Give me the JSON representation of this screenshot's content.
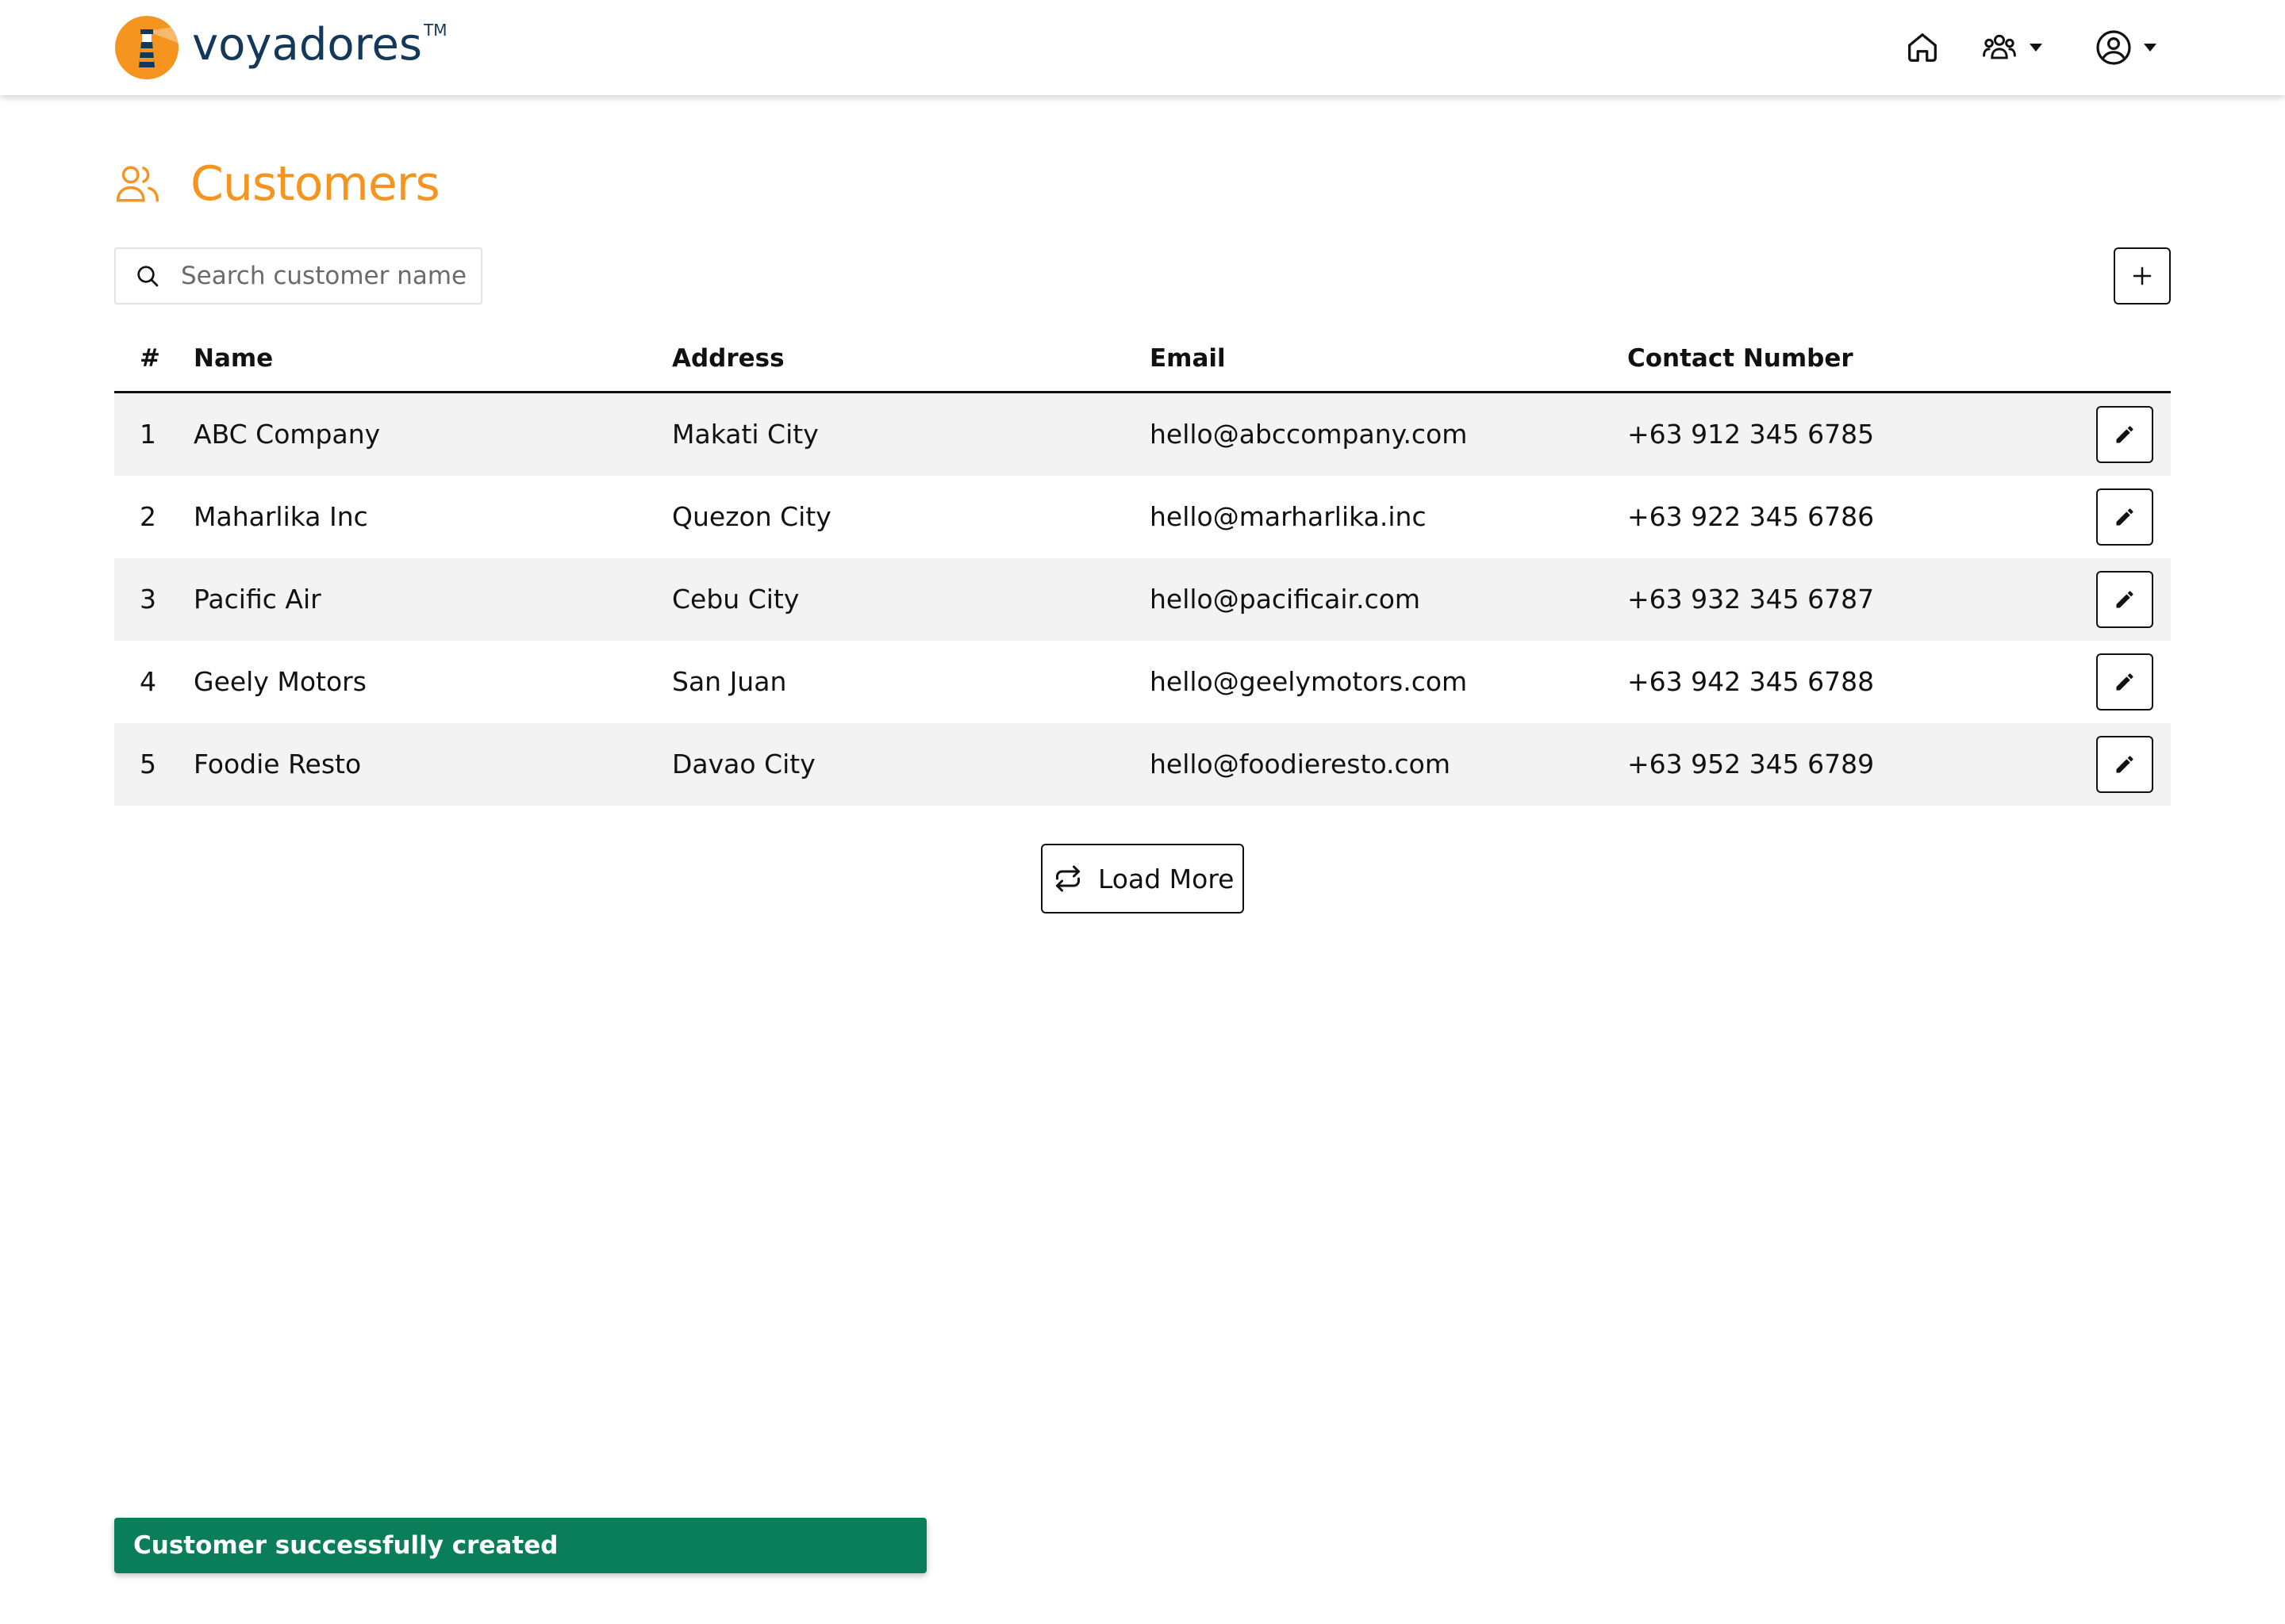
{
  "header": {
    "brand": "voyadores",
    "trademark": "TM",
    "brand_color": "#13385a",
    "accent_color": "#f5941e",
    "nav": [
      {
        "icon": "home-icon"
      },
      {
        "icon": "team-icon",
        "dropdown": true
      },
      {
        "icon": "user-icon",
        "dropdown": true
      }
    ]
  },
  "page": {
    "title": "Customers",
    "title_icon": "users-icon"
  },
  "search": {
    "placeholder": "Search customer name",
    "value": ""
  },
  "table": {
    "columns": [
      "#",
      "Name",
      "Address",
      "Email",
      "Contact Number"
    ],
    "rows": [
      {
        "num": "1",
        "name": "ABC Company",
        "address": "Makati City",
        "email": "hello@abccompany.com",
        "contact": "+63 912 345 6785"
      },
      {
        "num": "2",
        "name": "Maharlika Inc",
        "address": "Quezon City",
        "email": "hello@marharlika.inc",
        "contact": "+63 922 345 6786"
      },
      {
        "num": "3",
        "name": "Pacific Air",
        "address": "Cebu City",
        "email": "hello@pacificair.com",
        "contact": "+63 932 345 6787"
      },
      {
        "num": "4",
        "name": "Geely Motors",
        "address": "San Juan",
        "email": "hello@geelymotors.com",
        "contact": "+63 942 345 6788"
      },
      {
        "num": "5",
        "name": "Foodie Resto",
        "address": "Davao City",
        "email": "hello@foodieresto.com",
        "contact": "+63 952 345 6789"
      }
    ]
  },
  "load_more": {
    "label": "Load More"
  },
  "toast": {
    "message": "Customer successfully created",
    "color": "#0a7e58"
  }
}
